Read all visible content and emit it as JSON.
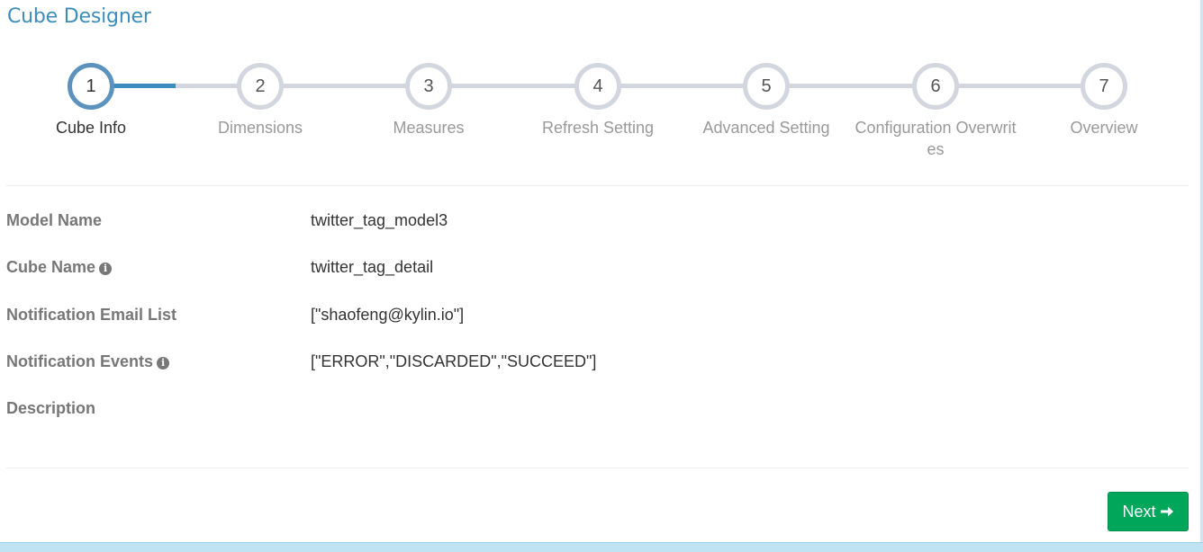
{
  "page": {
    "title": "Cube Designer"
  },
  "wizard": {
    "steps": [
      {
        "number": "1",
        "label": "Cube Info",
        "active": true
      },
      {
        "number": "2",
        "label": "Dimensions",
        "active": false
      },
      {
        "number": "3",
        "label": "Measures",
        "active": false
      },
      {
        "number": "4",
        "label": "Refresh Setting",
        "active": false
      },
      {
        "number": "5",
        "label": "Advanced Setting",
        "active": false
      },
      {
        "number": "6",
        "label": "Configuration Overwrites",
        "active": false
      },
      {
        "number": "7",
        "label": "Overview",
        "active": false
      }
    ]
  },
  "form": {
    "model_name": {
      "label": "Model Name",
      "value": "twitter_tag_model3"
    },
    "cube_name": {
      "label": "Cube Name",
      "value": "twitter_tag_detail"
    },
    "notification_email": {
      "label": "Notification Email List",
      "value": "[\"shaofeng@kylin.io\"]"
    },
    "notification_events": {
      "label": "Notification Events",
      "value": "[\"ERROR\",\"DISCARDED\",\"SUCCEED\"]"
    },
    "description": {
      "label": "Description",
      "value": ""
    }
  },
  "actions": {
    "next_label": "Next",
    "next_icon": "arrow-right-icon"
  },
  "colors": {
    "title": "#3c8dbc",
    "active_step": "#5b93be",
    "inactive_step": "#d2d6de",
    "next_button": "#00a65a"
  }
}
